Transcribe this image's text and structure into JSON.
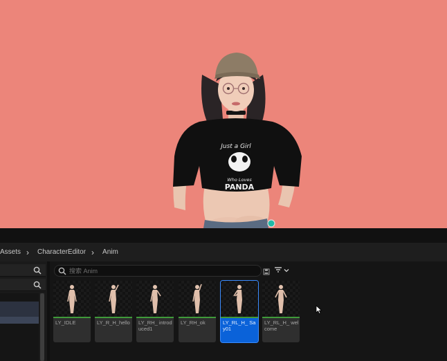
{
  "breadcrumb": {
    "items": [
      "Assets",
      "CharacterEditor",
      "Anim"
    ]
  },
  "left_panel": {
    "search_icon": "search-icon",
    "filter_search_icon": "search-icon"
  },
  "asset_browser": {
    "search_placeholder": "搜索 Anim",
    "save_icon": "save-icon",
    "filter_icon": "filter-icon",
    "filter_dropdown_icon": "chevron-down-icon",
    "assets": [
      {
        "label": "LY_IDLE",
        "selected": false
      },
      {
        "label": "LY_R_H_hello",
        "selected": false
      },
      {
        "label": "LY_RH_ introduced1",
        "selected": false
      },
      {
        "label": "LY_RH_ok",
        "selected": false
      },
      {
        "label": "LY_RL_H_ Say01",
        "selected": true
      },
      {
        "label": "LY_RL_H_ welcome",
        "selected": false
      }
    ]
  },
  "colors": {
    "viewport_bg": "#ec857a",
    "selection": "#0a62d9",
    "asset_ready": "#3f9a3a"
  }
}
